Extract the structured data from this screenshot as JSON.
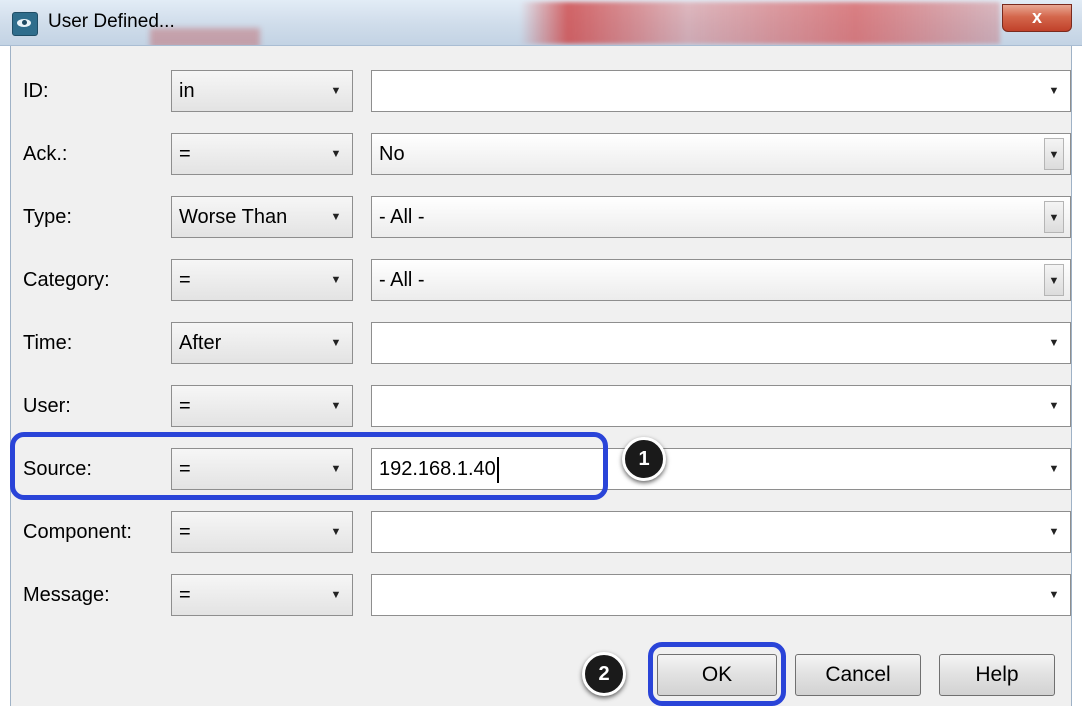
{
  "window": {
    "title": "User Defined...",
    "close_label": "x"
  },
  "filters": [
    {
      "label": "ID:",
      "operator": "in",
      "value": ""
    },
    {
      "label": "Ack.:",
      "operator": "=",
      "value": "No"
    },
    {
      "label": "Type:",
      "operator": "Worse Than",
      "value": "- All -"
    },
    {
      "label": "Category:",
      "operator": "=",
      "value": "- All -"
    },
    {
      "label": "Time:",
      "operator": "After",
      "value": ""
    },
    {
      "label": "User:",
      "operator": "=",
      "value": ""
    },
    {
      "label": "Source:",
      "operator": "=",
      "value": "192.168.1.40"
    },
    {
      "label": "Component:",
      "operator": "=",
      "value": ""
    },
    {
      "label": "Message:",
      "operator": "=",
      "value": ""
    }
  ],
  "buttons": {
    "ok": "OK",
    "cancel": "Cancel",
    "help": "Help"
  },
  "annotations": {
    "step1": "1",
    "step2": "2"
  },
  "colors": {
    "highlight": "#2a44d8",
    "close_button": "#c0412a"
  }
}
